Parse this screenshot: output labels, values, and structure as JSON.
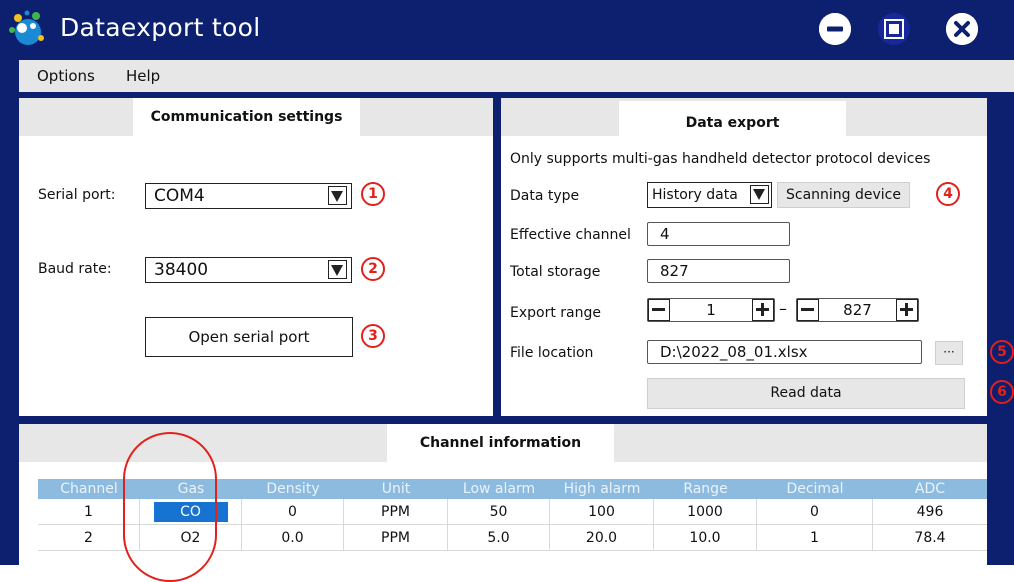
{
  "window": {
    "title": "Dataexport tool",
    "logo_icon": "bubbles-logo-icon",
    "controls": [
      "minimize-icon",
      "maximize-icon",
      "close-icon"
    ]
  },
  "menu": {
    "items": [
      "Options",
      "Help"
    ]
  },
  "communication": {
    "tab_label": "Communication settings",
    "serial_port_label": "Serial port:",
    "serial_port_value": "COM4",
    "baud_rate_label": "Baud rate:",
    "baud_rate_value": "38400",
    "open_button": "Open serial port"
  },
  "export": {
    "tab_label": "Data export",
    "note": "Only supports multi-gas handheld detector protocol devices",
    "data_type_label": "Data type",
    "data_type_value": "History data",
    "scan_button": "Scanning device",
    "channel_label": "Effective channel",
    "channel_value": "4",
    "storage_label": "Total storage",
    "storage_value": "827",
    "range_label": "Export range",
    "range_start": "1",
    "range_dash": "–",
    "range_end": "827",
    "file_label": "File location",
    "file_value": "D:\\2022_08_01.xlsx",
    "browse_button": "···",
    "read_button": "Read data"
  },
  "annotations": {
    "badge1": "1",
    "badge2": "2",
    "badge3": "3",
    "badge4": "4",
    "badge5": "5",
    "badge6": "6",
    "color": "#e2201c"
  },
  "channels": {
    "tab_label": "Channel information",
    "columns": [
      "Channel",
      "Gas",
      "Density",
      "Unit",
      "Low alarm",
      "High alarm",
      "Range",
      "Decimal",
      "ADC"
    ],
    "rows": [
      [
        "1",
        "CO",
        "0",
        "PPM",
        "50",
        "100",
        "1000",
        "0",
        "496"
      ],
      [
        "2",
        "O2",
        "0.0",
        "PPM",
        "5.0",
        "20.0",
        "10.0",
        "1",
        "78.4"
      ]
    ]
  },
  "colors": {
    "titlebar": "#0d1f6f",
    "header": "#8dbbe0",
    "selection": "#1673d1"
  }
}
